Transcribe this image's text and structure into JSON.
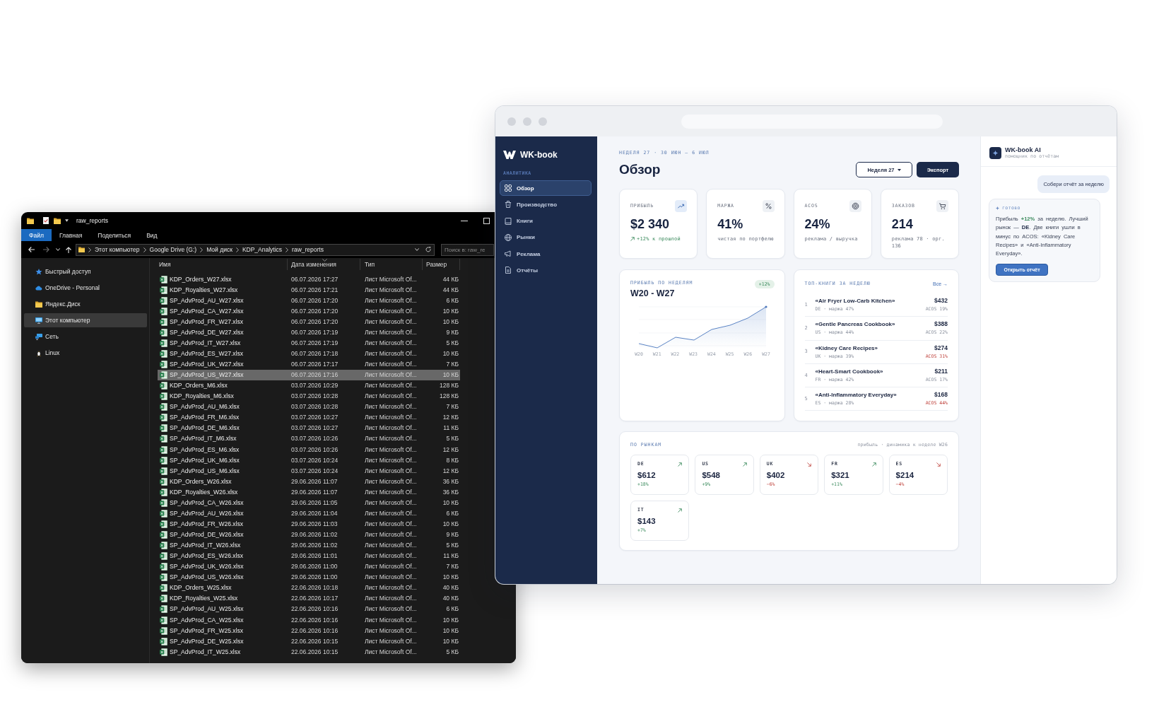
{
  "explorer": {
    "title": "raw_reports",
    "ribbon_tabs": [
      {
        "label": "Файл",
        "selected": true
      },
      {
        "label": "Главная",
        "selected": false
      },
      {
        "label": "Поделиться",
        "selected": false
      },
      {
        "label": "Вид",
        "selected": false
      }
    ],
    "nav_buttons": [
      {
        "kind": "back",
        "disabled": false
      },
      {
        "kind": "forward",
        "disabled": true
      },
      {
        "kind": "recent",
        "disabled": false
      },
      {
        "kind": "up",
        "disabled": false
      }
    ],
    "breadcrumb": [
      "Этот компьютер",
      "Google Drive (G:)",
      "Мой диск",
      "KDP_Analytics",
      "raw_reports"
    ],
    "search": {
      "placeholder": "Поиск в: raw_re"
    },
    "sidebar": [
      {
        "label": "Быстрый доступ",
        "kind": "quick",
        "selected": false
      },
      {
        "label": "OneDrive - Personal",
        "kind": "cloud",
        "selected": false
      },
      {
        "label": "Яндекс.Диск",
        "kind": "folder",
        "selected": false
      },
      {
        "label": "Этот компьютер",
        "kind": "computer",
        "selected": true
      },
      {
        "label": "Сеть",
        "kind": "network",
        "selected": false
      },
      {
        "label": "Linux",
        "kind": "linux",
        "selected": false
      }
    ],
    "columns": [
      {
        "label": "Имя",
        "sorted": false
      },
      {
        "label": "Дата изменения",
        "sorted": true
      },
      {
        "label": "Тип",
        "sorted": false
      },
      {
        "label": "Размер",
        "sorted": false
      }
    ],
    "files": [
      {
        "name": "KDP_Orders_W27.xlsx",
        "modified": "06.07.2026 17:27",
        "type": "Лист Microsoft Of...",
        "size": "44 КБ",
        "selected": false
      },
      {
        "name": "KDP_Royalties_W27.xlsx",
        "modified": "06.07.2026 17:21",
        "type": "Лист Microsoft Of...",
        "size": "44 КБ",
        "selected": false
      },
      {
        "name": "SP_AdvProd_AU_W27.xlsx",
        "modified": "06.07.2026 17:20",
        "type": "Лист Microsoft Of...",
        "size": "6 КБ",
        "selected": false
      },
      {
        "name": "SP_AdvProd_CA_W27.xlsx",
        "modified": "06.07.2026 17:20",
        "type": "Лист Microsoft Of...",
        "size": "10 КБ",
        "selected": false
      },
      {
        "name": "SP_AdvProd_FR_W27.xlsx",
        "modified": "06.07.2026 17:20",
        "type": "Лист Microsoft Of...",
        "size": "10 КБ",
        "selected": false
      },
      {
        "name": "SP_AdvProd_DE_W27.xlsx",
        "modified": "06.07.2026 17:19",
        "type": "Лист Microsoft Of...",
        "size": "9 КБ",
        "selected": false
      },
      {
        "name": "SP_AdvProd_IT_W27.xlsx",
        "modified": "06.07.2026 17:19",
        "type": "Лист Microsoft Of...",
        "size": "5 КБ",
        "selected": false
      },
      {
        "name": "SP_AdvProd_ES_W27.xlsx",
        "modified": "06.07.2026 17:18",
        "type": "Лист Microsoft Of...",
        "size": "10 КБ",
        "selected": false
      },
      {
        "name": "SP_AdvProd_UK_W27.xlsx",
        "modified": "06.07.2026 17:17",
        "type": "Лист Microsoft Of...",
        "size": "7 КБ",
        "selected": false
      },
      {
        "name": "SP_AdvProd_US_W27.xlsx",
        "modified": "06.07.2026 17:16",
        "type": "Лист Microsoft Of...",
        "size": "10 КБ",
        "selected": true
      },
      {
        "name": "KDP_Orders_M6.xlsx",
        "modified": "03.07.2026 10:29",
        "type": "Лист Microsoft Of...",
        "size": "128 КБ",
        "selected": false
      },
      {
        "name": "KDP_Royalties_M6.xlsx",
        "modified": "03.07.2026 10:28",
        "type": "Лист Microsoft Of...",
        "size": "128 КБ",
        "selected": false
      },
      {
        "name": "SP_AdvProd_AU_M6.xlsx",
        "modified": "03.07.2026 10:28",
        "type": "Лист Microsoft Of...",
        "size": "7 КБ",
        "selected": false
      },
      {
        "name": "SP_AdvProd_FR_M6.xlsx",
        "modified": "03.07.2026 10:27",
        "type": "Лист Microsoft Of...",
        "size": "12 КБ",
        "selected": false
      },
      {
        "name": "SP_AdvProd_DE_M6.xlsx",
        "modified": "03.07.2026 10:27",
        "type": "Лист Microsoft Of...",
        "size": "11 КБ",
        "selected": false
      },
      {
        "name": "SP_AdvProd_IT_M6.xlsx",
        "modified": "03.07.2026 10:26",
        "type": "Лист Microsoft Of...",
        "size": "5 КБ",
        "selected": false
      },
      {
        "name": "SP_AdvProd_ES_M6.xlsx",
        "modified": "03.07.2026 10:26",
        "type": "Лист Microsoft Of...",
        "size": "12 КБ",
        "selected": false
      },
      {
        "name": "SP_AdvProd_UK_M6.xlsx",
        "modified": "03.07.2026 10:24",
        "type": "Лист Microsoft Of...",
        "size": "8 КБ",
        "selected": false
      },
      {
        "name": "SP_AdvProd_US_M6.xlsx",
        "modified": "03.07.2026 10:24",
        "type": "Лист Microsoft Of...",
        "size": "12 КБ",
        "selected": false
      },
      {
        "name": "KDP_Orders_W26.xlsx",
        "modified": "29.06.2026 11:07",
        "type": "Лист Microsoft Of...",
        "size": "36 КБ",
        "selected": false
      },
      {
        "name": "KDP_Royalties_W26.xlsx",
        "modified": "29.06.2026 11:07",
        "type": "Лист Microsoft Of...",
        "size": "36 КБ",
        "selected": false
      },
      {
        "name": "SP_AdvProd_CA_W26.xlsx",
        "modified": "29.06.2026 11:05",
        "type": "Лист Microsoft Of...",
        "size": "10 КБ",
        "selected": false
      },
      {
        "name": "SP_AdvProd_AU_W26.xlsx",
        "modified": "29.06.2026 11:04",
        "type": "Лист Microsoft Of...",
        "size": "6 КБ",
        "selected": false
      },
      {
        "name": "SP_AdvProd_FR_W26.xlsx",
        "modified": "29.06.2026 11:03",
        "type": "Лист Microsoft Of...",
        "size": "10 КБ",
        "selected": false
      },
      {
        "name": "SP_AdvProd_DE_W26.xlsx",
        "modified": "29.06.2026 11:02",
        "type": "Лист Microsoft Of...",
        "size": "9 КБ",
        "selected": false
      },
      {
        "name": "SP_AdvProd_IT_W26.xlsx",
        "modified": "29.06.2026 11:02",
        "type": "Лист Microsoft Of...",
        "size": "5 КБ",
        "selected": false
      },
      {
        "name": "SP_AdvProd_ES_W26.xlsx",
        "modified": "29.06.2026 11:01",
        "type": "Лист Microsoft Of...",
        "size": "11 КБ",
        "selected": false
      },
      {
        "name": "SP_AdvProd_UK_W26.xlsx",
        "modified": "29.06.2026 11:00",
        "type": "Лист Microsoft Of...",
        "size": "7 КБ",
        "selected": false
      },
      {
        "name": "SP_AdvProd_US_W26.xlsx",
        "modified": "29.06.2026 11:00",
        "type": "Лист Microsoft Of...",
        "size": "10 КБ",
        "selected": false
      },
      {
        "name": "KDP_Orders_W25.xlsx",
        "modified": "22.06.2026 10:18",
        "type": "Лист Microsoft Of...",
        "size": "40 КБ",
        "selected": false
      },
      {
        "name": "KDP_Royalties_W25.xlsx",
        "modified": "22.06.2026 10:17",
        "type": "Лист Microsoft Of...",
        "size": "40 КБ",
        "selected": false
      },
      {
        "name": "SP_AdvProd_AU_W25.xlsx",
        "modified": "22.06.2026 10:16",
        "type": "Лист Microsoft Of...",
        "size": "6 КБ",
        "selected": false
      },
      {
        "name": "SP_AdvProd_CA_W25.xlsx",
        "modified": "22.06.2026 10:16",
        "type": "Лист Microsoft Of...",
        "size": "10 КБ",
        "selected": false
      },
      {
        "name": "SP_AdvProd_FR_W25.xlsx",
        "modified": "22.06.2026 10:16",
        "type": "Лист Microsoft Of...",
        "size": "10 КБ",
        "selected": false
      },
      {
        "name": "SP_AdvProd_DE_W25.xlsx",
        "modified": "22.06.2026 10:15",
        "type": "Лист Microsoft Of...",
        "size": "10 КБ",
        "selected": false
      },
      {
        "name": "SP_AdvProd_IT_W25.xlsx",
        "modified": "22.06.2026 10:15",
        "type": "Лист Microsoft Of...",
        "size": "5 КБ",
        "selected": false
      }
    ]
  },
  "dashboard": {
    "brand": "WK-book",
    "nav_section": "АНАЛИТИКА",
    "nav": [
      {
        "label": "Обзор",
        "kind": "overview",
        "selected": true
      },
      {
        "label": "Производство",
        "kind": "production",
        "selected": false
      },
      {
        "label": "Книги",
        "kind": "books",
        "selected": false
      },
      {
        "label": "Рынки",
        "kind": "markets",
        "selected": false
      },
      {
        "label": "Реклама",
        "kind": "ads",
        "selected": false
      },
      {
        "label": "Отчёты",
        "kind": "reports",
        "selected": false
      }
    ],
    "eyebrow": "НЕДЕЛЯ 27 · 30 ИЮН – 6 ИЮЛ",
    "title": "Обзор",
    "week_button": "Неделя 27",
    "export_button": "Экспорт",
    "kpis": [
      {
        "kind": "profit",
        "label": "ПРИБЫЛЬ",
        "value": "$2 340",
        "note": "+12% к прошлой",
        "positive": true
      },
      {
        "kind": "margin",
        "label": "МАРЖА",
        "value": "41%",
        "note": "чистая по портфелю",
        "positive": false
      },
      {
        "kind": "acos",
        "label": "ACOS",
        "value": "24%",
        "note": "реклама / выручка",
        "positive": false
      },
      {
        "kind": "orders",
        "label": "ЗАКАЗОВ",
        "value": "214",
        "note": "реклама 78 · орг. 136",
        "positive": false
      }
    ],
    "weekly_chart": {
      "label": "ПРИБЫЛЬ ПО НЕДЕЛЯМ",
      "title": "W20 - W27",
      "badge": "+12%",
      "x_labels": [
        "W20",
        "W21",
        "W22",
        "W23",
        "W24",
        "W25",
        "W26",
        "W27"
      ]
    },
    "top_books": {
      "label": "ТОП-КНИГИ ЗА НЕДЕЛЮ",
      "link": "Все →",
      "rows": [
        {
          "rank": "1",
          "title": "«Air Fryer Low-Carb Kitchen»",
          "meta": "DE · маржа 47%",
          "profit": "$432",
          "acos": "ACOS 19%",
          "alert": false
        },
        {
          "rank": "2",
          "title": "«Gentle Pancreas Cookbook»",
          "meta": "US · маржа 44%",
          "profit": "$388",
          "acos": "ACOS 22%",
          "alert": false
        },
        {
          "rank": "3",
          "title": "«Kidney Care Recipes»",
          "meta": "UK · маржа 39%",
          "profit": "$274",
          "acos": "ACOS 31%",
          "alert": true
        },
        {
          "rank": "4",
          "title": "«Heart-Smart Cookbook»",
          "meta": "FR · маржа 42%",
          "profit": "$211",
          "acos": "ACOS 17%",
          "alert": false
        },
        {
          "rank": "5",
          "title": "«Anti-Inflammatory Everyday»",
          "meta": "ES · маржа 28%",
          "profit": "$168",
          "acos": "ACOS 44%",
          "alert": true
        }
      ]
    },
    "markets": {
      "label": "ПО РЫНКАМ",
      "note": "прибыль · динамика к неделе W26",
      "items": [
        {
          "code": "DE",
          "value": "$612",
          "change": "+18%",
          "rising": true
        },
        {
          "code": "US",
          "value": "$548",
          "change": "+9%",
          "rising": true
        },
        {
          "code": "UK",
          "value": "$402",
          "change": "−6%",
          "rising": false
        },
        {
          "code": "FR",
          "value": "$321",
          "change": "+11%",
          "rising": true
        },
        {
          "code": "ES",
          "value": "$214",
          "change": "−4%",
          "rising": false
        },
        {
          "code": "IT",
          "value": "$143",
          "change": "+7%",
          "rising": true
        }
      ]
    }
  },
  "assistant": {
    "name": "WK-book AI",
    "subtitle": "помощник по отчётам",
    "user_message": "Собери отчёт за неделю",
    "reply": {
      "status": "готово",
      "parts": [
        {
          "text": "Прибыль ",
          "kind": "plain"
        },
        {
          "text": "+12%",
          "kind": "positive"
        },
        {
          "text": " за неделю. Лучший рынок — ",
          "kind": "plain"
        },
        {
          "text": "DE",
          "kind": "strong"
        },
        {
          "text": ". Две книги ушли в минус по ACOS: «Kidney Care Recipes» и «Anti-Inflammatory Everyday».",
          "kind": "plain"
        }
      ],
      "button": "Открыть отчёт"
    }
  }
}
